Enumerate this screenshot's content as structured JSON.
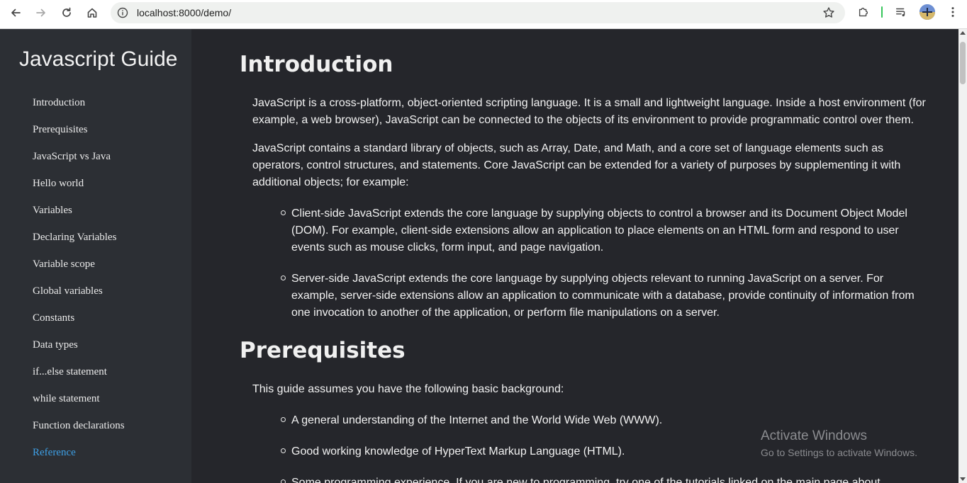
{
  "browser": {
    "url": "localhost:8000/demo/"
  },
  "sidebar": {
    "title": "Javascript Guide",
    "items": [
      {
        "label": "Introduction"
      },
      {
        "label": "Prerequisites"
      },
      {
        "label": "JavaScript vs Java"
      },
      {
        "label": "Hello world"
      },
      {
        "label": "Variables"
      },
      {
        "label": "Declaring Variables"
      },
      {
        "label": "Variable scope"
      },
      {
        "label": "Global variables"
      },
      {
        "label": "Constants"
      },
      {
        "label": "Data types"
      },
      {
        "label": "if...else statement"
      },
      {
        "label": "while statement"
      },
      {
        "label": "Function declarations"
      },
      {
        "label": "Reference"
      }
    ],
    "active_color": "#3ea0e6"
  },
  "main": {
    "introduction": {
      "heading": "Introduction",
      "p1": "JavaScript is a cross-platform, object-oriented scripting language. It is a small and lightweight language. Inside a host environment (for example, a web browser), JavaScript can be connected to the objects of its environment to provide programmatic control over them.",
      "p2": "JavaScript contains a standard library of objects, such as Array, Date, and Math, and a core set of language elements such as operators, control structures, and statements. Core JavaScript can be extended for a variety of purposes by supplementing it with additional objects; for example:",
      "bullets": [
        "Client-side JavaScript extends the core language by supplying objects to control a browser and its Document Object Model (DOM). For example, client-side extensions allow an application to place elements on an HTML form and respond to user events such as mouse clicks, form input, and page navigation.",
        "Server-side JavaScript extends the core language by supplying objects relevant to running JavaScript on a server. For example, server-side extensions allow an application to communicate with a database, provide continuity of information from one invocation to another of the application, or perform file manipulations on a server."
      ]
    },
    "prerequisites": {
      "heading": "Prerequisites",
      "p1": "This guide assumes you have the following basic background:",
      "bullets": [
        "A general understanding of the Internet and the World Wide Web (WWW).",
        "Good working knowledge of HyperText Markup Language (HTML).",
        "Some programming experience. If you are new to programming, try one of the tutorials linked on the main page about"
      ]
    }
  },
  "watermark": {
    "title": "Activate Windows",
    "subtitle": "Go to Settings to activate Windows."
  }
}
